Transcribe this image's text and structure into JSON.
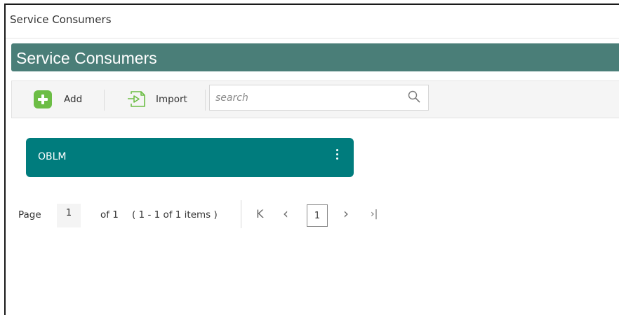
{
  "window": {
    "title": "Service Consumers"
  },
  "header": {
    "title": "Service Consumers"
  },
  "toolbar": {
    "add_label": "Add",
    "import_label": "Import",
    "search_placeholder": "search",
    "search_value": ""
  },
  "consumers": [
    {
      "name": "OBLM"
    }
  ],
  "pagination": {
    "page_label": "Page",
    "current_page": "1",
    "of_label": "of 1",
    "items_summary": "( 1 - 1 of 1 items )",
    "first_icon": "K",
    "prev_icon": "‹",
    "page_number": "1",
    "next_icon": "›",
    "last_icon": "›|"
  },
  "colors": {
    "header_bg": "#4a7e78",
    "card_bg": "#007c7d",
    "add_icon": "#6cbd45",
    "import_icon": "#6cbd45"
  }
}
